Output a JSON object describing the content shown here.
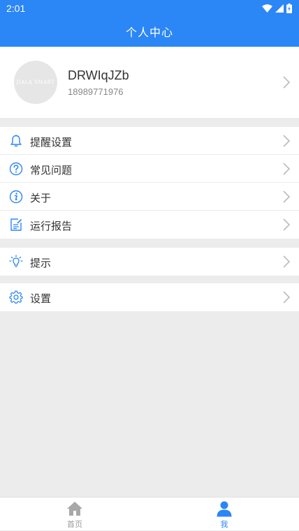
{
  "status_bar": {
    "time": "2:01"
  },
  "header": {
    "title": "个人中心"
  },
  "profile": {
    "avatar_text": "JIALA SMART",
    "username": "DRWIqJZb",
    "phone": "18989771976"
  },
  "menu": {
    "group1": [
      {
        "label": "提醒设置",
        "icon": "bell-icon"
      },
      {
        "label": "常见问题",
        "icon": "question-icon"
      },
      {
        "label": "关于",
        "icon": "info-icon"
      },
      {
        "label": "运行报告",
        "icon": "report-icon"
      }
    ],
    "group2": [
      {
        "label": "提示",
        "icon": "lightbulb-icon"
      }
    ],
    "group3": [
      {
        "label": "设置",
        "icon": "gear-icon"
      }
    ]
  },
  "bottom_nav": {
    "home_label": "首页",
    "me_label": "我"
  },
  "colors": {
    "accent": "#2b86f6",
    "inactive": "#999999",
    "background": "#ececec"
  }
}
